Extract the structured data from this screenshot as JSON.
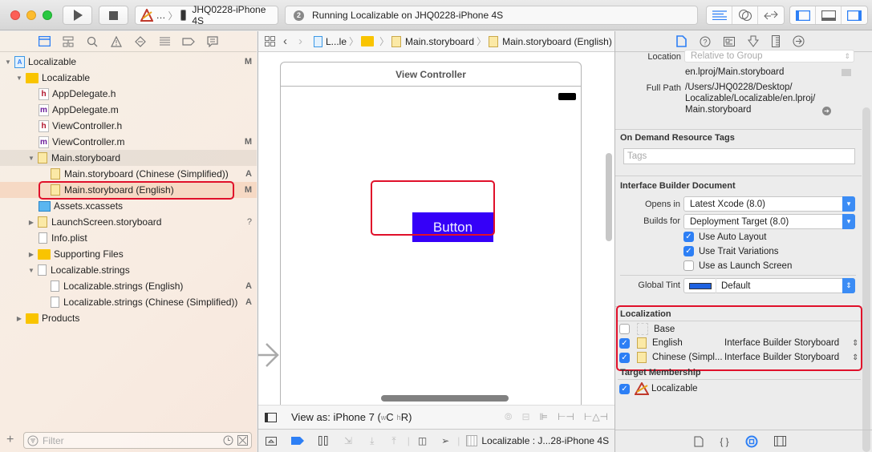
{
  "toolbar": {
    "scheme_app": "…",
    "scheme_device": "JHQ0228-iPhone 4S",
    "activity_badge": "2",
    "activity_text": "Running Localizable on JHQ0228-iPhone 4S"
  },
  "navigator": {
    "tabs": [
      "project-navigator",
      "symbol-navigator",
      "find-navigator",
      "issue-navigator",
      "test-navigator",
      "debug-navigator",
      "breakpoint-navigator",
      "report-navigator"
    ],
    "items": [
      {
        "label": "Localizable",
        "status": "M"
      },
      {
        "label": "Localizable",
        "status": ""
      },
      {
        "label": "AppDelegate.h",
        "status": ""
      },
      {
        "label": "AppDelegate.m",
        "status": ""
      },
      {
        "label": "ViewController.h",
        "status": ""
      },
      {
        "label": "ViewController.m",
        "status": "M"
      },
      {
        "label": "Main.storyboard",
        "status": ""
      },
      {
        "label": "Main.storyboard (Chinese (Simplified))",
        "status": "A"
      },
      {
        "label": "Main.storyboard (English)",
        "status": "M"
      },
      {
        "label": "Assets.xcassets",
        "status": ""
      },
      {
        "label": "LaunchScreen.storyboard",
        "status": "?"
      },
      {
        "label": "Info.plist",
        "status": ""
      },
      {
        "label": "Supporting Files",
        "status": ""
      },
      {
        "label": "Localizable.strings",
        "status": ""
      },
      {
        "label": "Localizable.strings (English)",
        "status": "A"
      },
      {
        "label": "Localizable.strings (Chinese (Simplified))",
        "status": "A"
      },
      {
        "label": "Products",
        "status": ""
      }
    ],
    "filter_placeholder": "Filter"
  },
  "editor": {
    "jumpbar": [
      "L...le",
      "",
      "Main.storyboard",
      "Main.storyboard (English)"
    ],
    "scene_title": "View Controller",
    "button_label": "Button",
    "view_as": "View as: iPhone 7 (",
    "size_w": "w",
    "size_c": "C",
    "size_h": "h",
    "size_r": "R)",
    "debug_target": "Localizable : J...28-iPhone 4S"
  },
  "inspector": {
    "location_label": "Location",
    "location_value": "Relative to Group",
    "relative_path": "en.lproj/Main.storyboard",
    "full_path_label": "Full Path",
    "full_path_lines": [
      "/Users/JHQ0228/Desktop/",
      "Localizable/Localizable/en.lproj/",
      "Main.storyboard"
    ],
    "odr_title": "On Demand Resource Tags",
    "tags_placeholder": "Tags",
    "ibd_title": "Interface Builder Document",
    "opens_in_label": "Opens in",
    "opens_in_value": "Latest Xcode (8.0)",
    "builds_for_label": "Builds for",
    "builds_for_value": "Deployment Target (8.0)",
    "use_auto_layout": "Use Auto Layout",
    "use_trait_variations": "Use Trait Variations",
    "use_launch_screen": "Use as Launch Screen",
    "global_tint_label": "Global Tint",
    "global_tint_value": "Default",
    "global_tint_color": "#1f62e0",
    "localization_title": "Localization",
    "localizations": [
      {
        "name": "Base",
        "type": "",
        "checked": false
      },
      {
        "name": "English",
        "type": "Interface Builder Storyboard",
        "checked": true
      },
      {
        "name": "Chinese (Simpl...",
        "type": "Interface Builder Storyboard",
        "checked": true
      }
    ],
    "target_membership_title": "Target Membership",
    "target_name": "Localizable"
  },
  "colors": {
    "accent": "#2d7ff5",
    "highlight": "#e0102a",
    "button_bg": "#3500f8"
  }
}
